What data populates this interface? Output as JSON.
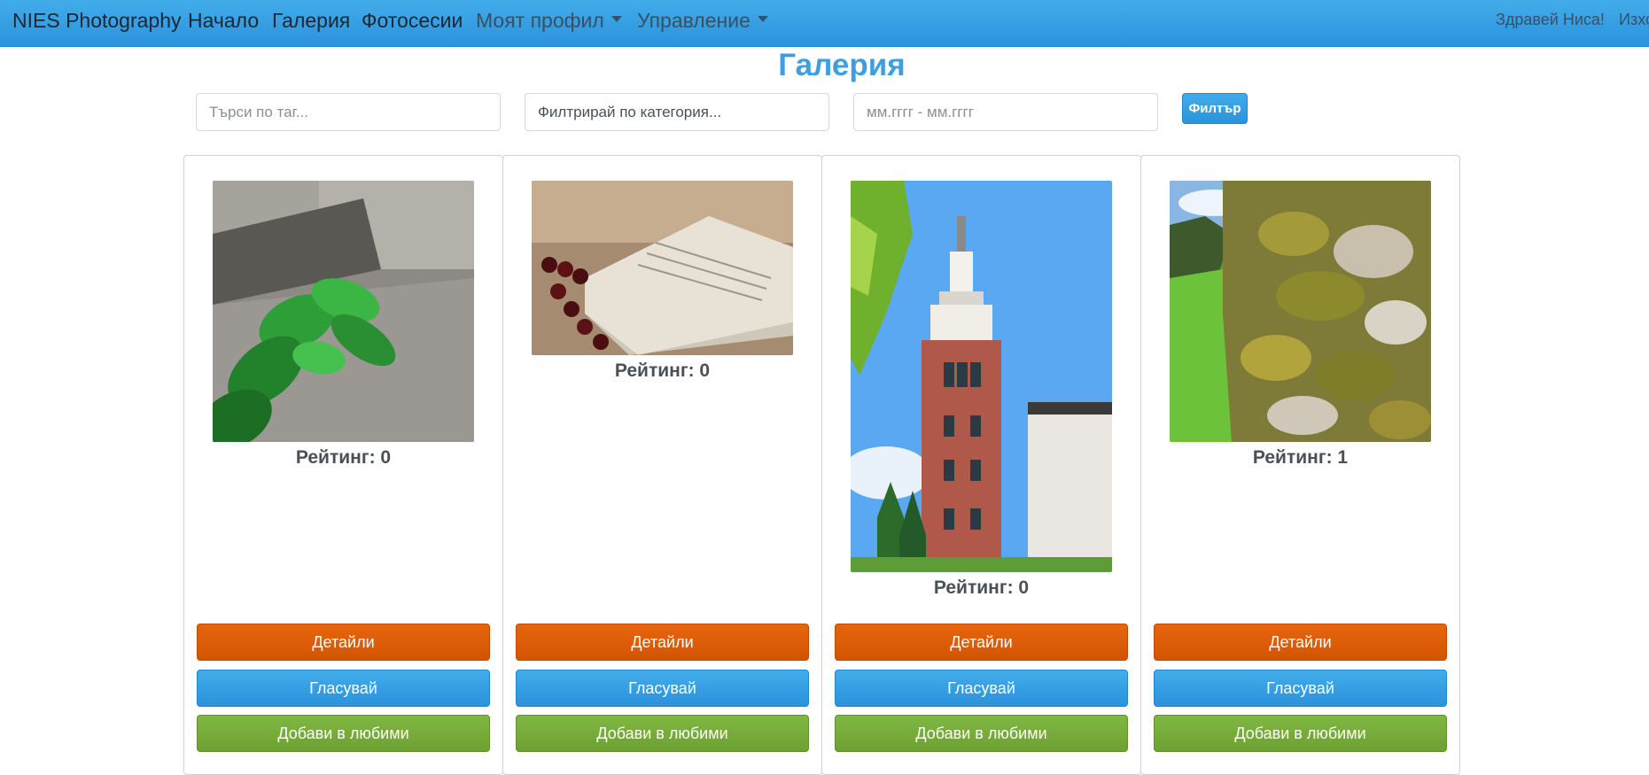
{
  "navbar": {
    "brand": "NIES Photography",
    "links": [
      "Начало",
      "Галерия",
      "Фотосесии"
    ],
    "dropdowns": [
      "Моят профил",
      "Управление"
    ],
    "greeting": "Здравей Ниса!",
    "logout": "Изход"
  },
  "page": {
    "title": "Галерия"
  },
  "filters": {
    "tag_placeholder": "Търси по таг...",
    "category_value": "Филтрирай по категория...",
    "date_placeholder": "мм.гггг - мм.гггг",
    "button": "Филтър"
  },
  "cards": [
    {
      "rating": "Рейтинг: 0",
      "image": "plant-on-stone-photo"
    },
    {
      "rating": "Рейтинг: 0",
      "image": "open-book-with-beads-photo"
    },
    {
      "rating": "Рейтинг: 0",
      "image": "clock-tower-building-photo"
    },
    {
      "rating": "Рейтинг: 1",
      "image": "mossy-stone-wall-photo"
    }
  ],
  "buttons": {
    "details": "Детайли",
    "vote": "Гласувай",
    "favorite": "Добави в любими"
  },
  "watermark": "NIES",
  "colors": {
    "navbar": "#2a93dc",
    "title": "#3d9fdf",
    "details": "#d35400",
    "vote": "#2a93dc",
    "favorite": "#6da233"
  }
}
